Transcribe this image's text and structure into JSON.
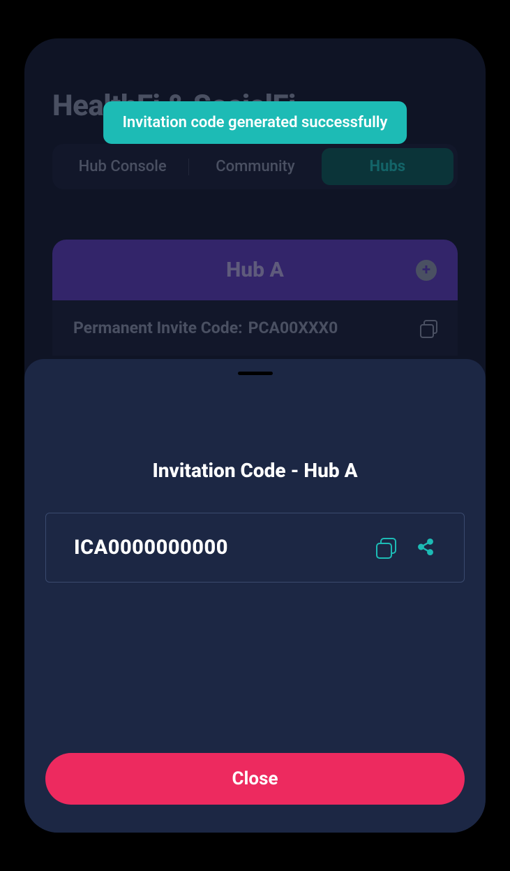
{
  "page": {
    "title": "HealthFi & SocialFi"
  },
  "toast": {
    "message": "Invitation code generated successfully"
  },
  "tabs": {
    "items": [
      {
        "label": "Hub Console"
      },
      {
        "label": "Community"
      },
      {
        "label": "Hubs"
      }
    ]
  },
  "hub": {
    "name": "Hub A",
    "permanent_invite": {
      "label": "Permanent Invite Code:",
      "code": "PCA00XXX0"
    }
  },
  "modal": {
    "title": "Invitation Code - Hub A",
    "code": "ICA0000000000",
    "close_label": "Close"
  },
  "colors": {
    "accent": "#1dbbb5",
    "primary": "#5d3cb8",
    "danger": "#ed2a5f",
    "bg_dark": "#141a2e",
    "bg_sheet": "#1c2744"
  }
}
